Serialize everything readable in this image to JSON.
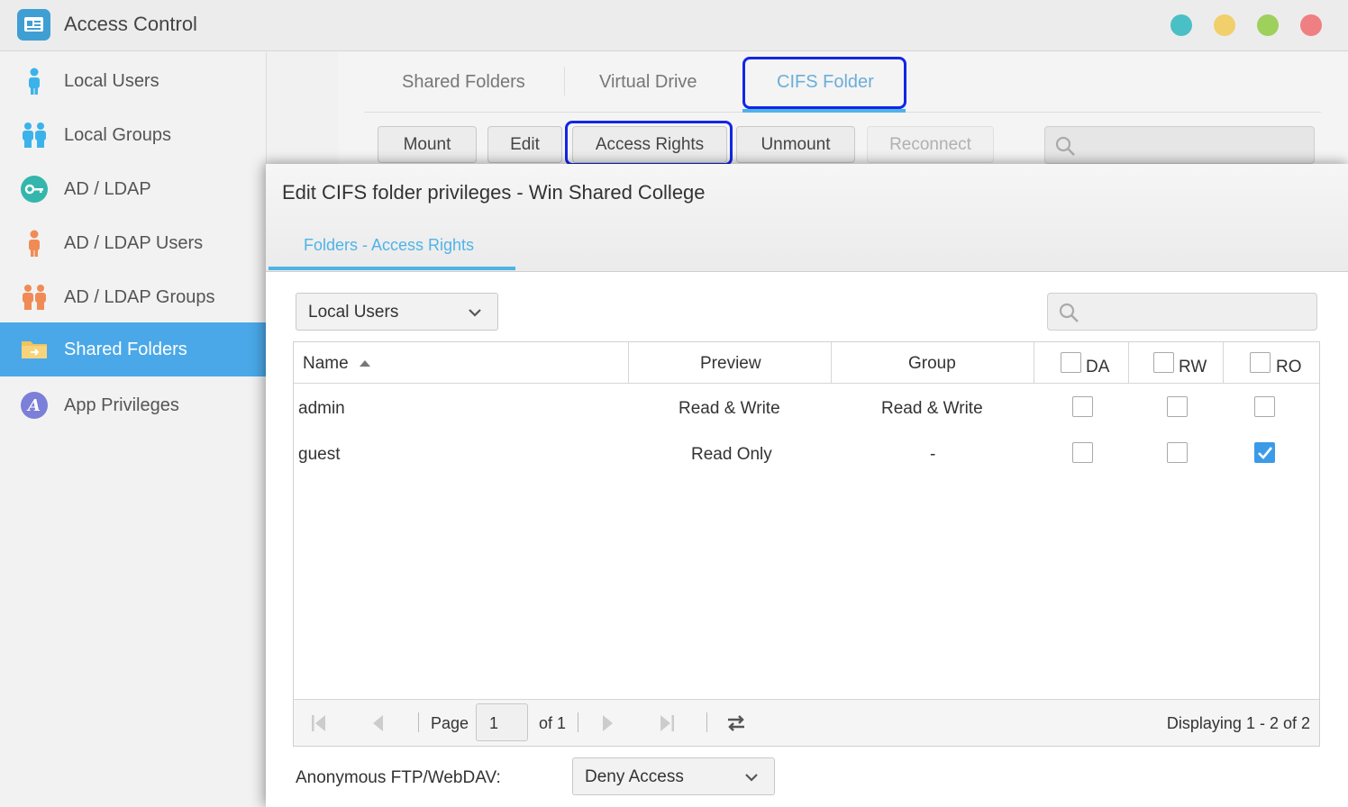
{
  "app": {
    "title": "Access Control"
  },
  "window_buttons": [
    {
      "name": "teal",
      "color": "#4bbfc6"
    },
    {
      "name": "yellow",
      "color": "#f1cf6b"
    },
    {
      "name": "green",
      "color": "#9ed05c"
    },
    {
      "name": "red",
      "color": "#f07f84"
    }
  ],
  "sidebar": {
    "items": [
      {
        "label": "Local Users",
        "icon": "user-icon"
      },
      {
        "label": "Local Groups",
        "icon": "users-icon"
      },
      {
        "label": "AD / LDAP",
        "icon": "key-icon"
      },
      {
        "label": "AD / LDAP Users",
        "icon": "user-icon"
      },
      {
        "label": "AD / LDAP Groups",
        "icon": "users-icon"
      },
      {
        "label": "Shared Folders",
        "icon": "folder-icon",
        "active": true
      },
      {
        "label": "App Privileges",
        "icon": "app-icon"
      }
    ]
  },
  "tabs": [
    {
      "label": "Shared Folders"
    },
    {
      "label": "Virtual Drive"
    },
    {
      "label": "CIFS Folder",
      "active": true
    }
  ],
  "toolbar": {
    "mount": "Mount",
    "edit": "Edit",
    "access_rights": "Access Rights",
    "unmount": "Unmount",
    "reconnect": "Reconnect"
  },
  "dialog": {
    "title": "Edit CIFS folder privileges - Win Shared College",
    "tab": "Folders - Access Rights",
    "user_type_select": "Local Users",
    "columns": {
      "name": "Name",
      "preview": "Preview",
      "group": "Group",
      "da": "DA",
      "rw": "RW",
      "ro": "RO"
    },
    "rows": [
      {
        "name": "admin",
        "preview": "Read & Write",
        "group": "Read & Write",
        "da": false,
        "rw": false,
        "ro": false
      },
      {
        "name": "guest",
        "preview": "Read Only",
        "group": "-",
        "da": false,
        "rw": false,
        "ro": true
      }
    ],
    "pager": {
      "page_label": "Page",
      "page_value": "1",
      "of_label": "of 1",
      "displaying": "Displaying 1 - 2 of 2"
    },
    "anon": {
      "label": "Anonymous FTP/WebDAV:",
      "value": "Deny Access"
    }
  },
  "colors": {
    "accent": "#4aa8e8",
    "highlight": "#1326e6",
    "check": "#3c9be8"
  }
}
